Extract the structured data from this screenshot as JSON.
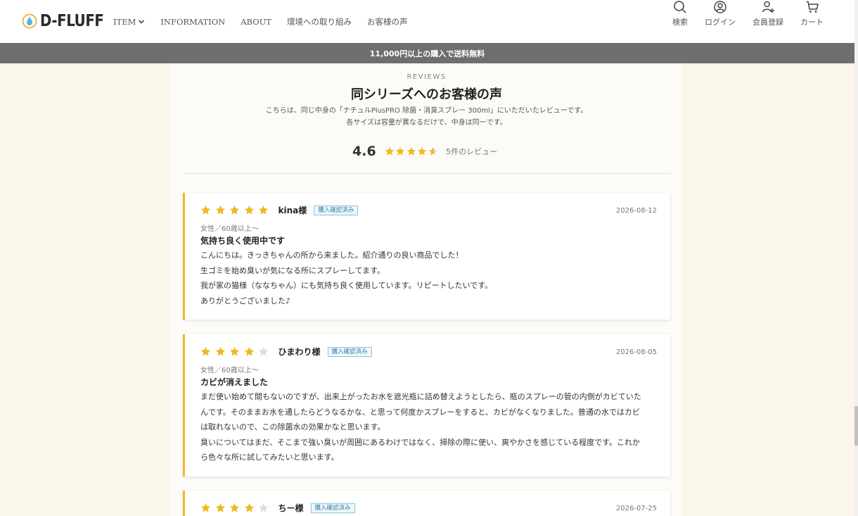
{
  "header": {
    "logo_text": "D-FLUFF",
    "nav": [
      {
        "label": "ITEM"
      },
      {
        "label": "INFORMATION"
      },
      {
        "label": "ABOUT"
      },
      {
        "label": "環境への取り組み"
      },
      {
        "label": "お客様の声"
      }
    ],
    "icons": [
      {
        "label": "検索",
        "icon": "search-icon"
      },
      {
        "label": "ログイン",
        "icon": "user-circle-icon"
      },
      {
        "label": "会員登録",
        "icon": "user-plus-icon"
      },
      {
        "label": "カート",
        "icon": "cart-icon"
      }
    ]
  },
  "banner": {
    "text": "11,000円以上の購入で送料無料"
  },
  "reviews": {
    "label": "REVIEWS",
    "title": "同シリーズへのお客様の声",
    "desc_line1": "こちらは、同じ中身の「ナチュルPlusPRO 除菌・消臭スプレー 300ml」にいただいたレビューです。",
    "desc_line2": "各サイズは容量が異なるだけで、中身は同一です。",
    "average": "4.6",
    "average_rating": 4.6,
    "count_text": "5件のレビュー"
  },
  "cards": [
    {
      "rating": 5,
      "name": "kina様",
      "badge": "購入確認済み",
      "date": "2026-08-12",
      "meta": "女性／60歳以上〜",
      "title": "気持ち良く使用中です",
      "lines": [
        "こんにちは。きっきちゃんの所から来ました。紹介通りの良い商品でした！",
        "生ゴミを始め臭いが気になる所にスプレーしてます。",
        "我が家の猫様（ななちゃん）にも気持ち良く使用しています。リピートしたいです。",
        "ありがとうございました♪"
      ]
    },
    {
      "rating": 4,
      "name": "ひまわり様",
      "badge": "購入確認済み",
      "date": "2026-08-05",
      "meta": "女性／60歳以上〜",
      "title": "カビが消えました",
      "lines": [
        "まだ使い始めて間もないのですが、出来上がったお水を遮光瓶に詰め替えようとしたら、瓶のスプレーの管の内側がカビていた",
        "んです。そのままお水を通したらどうなるかな、と思って何度かスプレーをすると、カビがなくなりました。普通の水ではカビ",
        "は取れないので、この除菌水の効果かなと思います。",
        "臭いについてはまだ、そこまで強い臭いが周囲にあるわけではなく、掃除の際に使い、爽やかさを感じている程度です。これか",
        "ら色々な所に試してみたいと思います。"
      ]
    },
    {
      "rating": 4,
      "name": "ちー様",
      "badge": "購入確認済み",
      "date": "2026-07-25",
      "meta": "",
      "title": "",
      "lines": []
    }
  ],
  "colors": {
    "star": "#f0b823",
    "star_empty": "#dddddd",
    "accent": "#f0b823",
    "banner": "#6e6e6e"
  }
}
